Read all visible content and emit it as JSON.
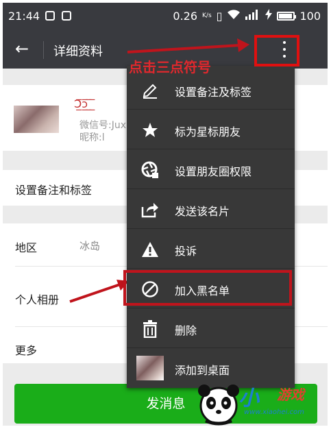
{
  "status_bar": {
    "time": "21:44",
    "speed": "0.26",
    "speed_unit": "K/s",
    "battery": "100"
  },
  "action_bar": {
    "back_glyph": "←",
    "title": "详细资料",
    "more_icon": "more-vertical-icon"
  },
  "annotation": {
    "tap_hint": "点击三点符号",
    "color": "#e0282d"
  },
  "profile": {
    "nickname": "Ↄ̲̅ↄ̲̅ ̲̅ ̲̅",
    "wechat_id_label": "微信号:",
    "wechat_id": "Jux",
    "nickname_label": "昵称:",
    "nickname_value": "l"
  },
  "rows": {
    "remark": "设置备注和标签",
    "region_label": "地区",
    "region_value": "冰岛",
    "album": "个人相册",
    "more": "更多"
  },
  "send_button": "发消息",
  "menu": {
    "items": [
      {
        "label": "设置备注及标签",
        "icon": "pencil-icon"
      },
      {
        "label": "标为星标朋友",
        "icon": "star-icon"
      },
      {
        "label": "设置朋友圈权限",
        "icon": "aperture-lock-icon"
      },
      {
        "label": "发送该名片",
        "icon": "share-icon"
      },
      {
        "label": "投诉",
        "icon": "warning-icon"
      },
      {
        "label": "加入黑名单",
        "icon": "block-icon"
      },
      {
        "label": "删除",
        "icon": "trash-icon"
      },
      {
        "label": "添加到桌面",
        "icon": "avatar-thumbnail"
      }
    ]
  },
  "watermark": {
    "brand_a": "小",
    "brand_b": "游戏",
    "url": "www.xiaohei.com"
  },
  "colors": {
    "bar_bg": "#393a3f",
    "menu_bg": "#383838",
    "send_green": "#1aad19",
    "highlight_red": "#c0141c"
  }
}
